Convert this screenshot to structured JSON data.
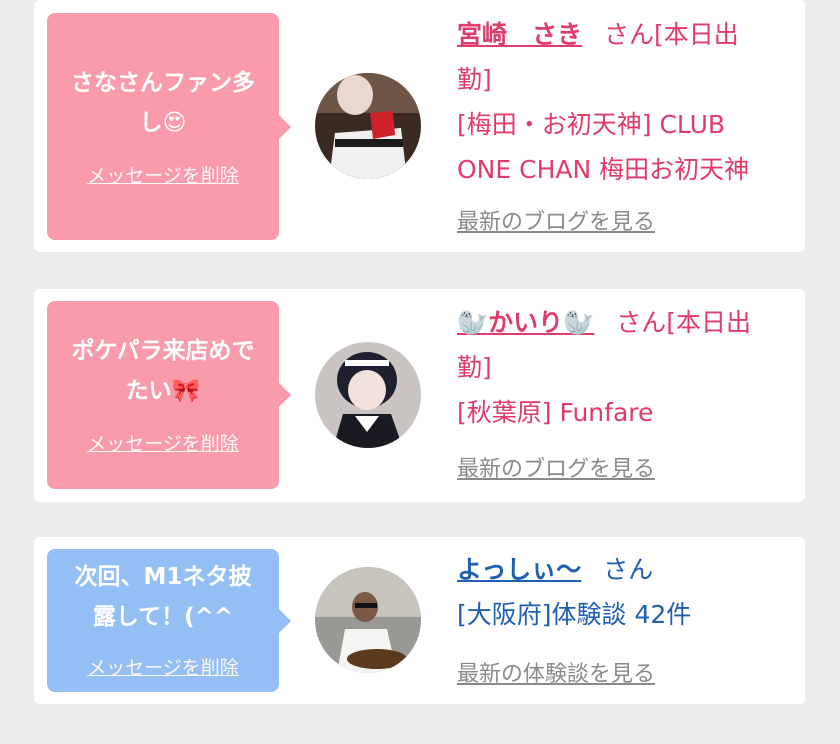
{
  "accent_pink": "#e03b6a",
  "accent_blue": "#1f5fb0",
  "cards": [
    {
      "message_line1": "さなさんファン多",
      "message_line2": "し",
      "message_emoji_icon": "heart-eyes-emoji",
      "message_emoji": "😍",
      "delete_label": "メッセージを削除",
      "name": "宮崎　さき",
      "suffix": "さん[本日出",
      "suffix2": "勤]",
      "shop_line1": "[梅田・お初天神] CLUB",
      "shop_line2": "ONE CHAN 梅田お初天神",
      "link_label": "最新のブログを見る"
    },
    {
      "message_line1": "ポケパラ来店めで",
      "message_line2": "たい",
      "message_emoji_icon": "ribbon-emoji",
      "message_emoji": "🎀",
      "delete_label": "メッセージを削除",
      "name_prefix_icon": "seal-emoji",
      "name_prefix": "🦭",
      "name": "かいり",
      "name_suffix": "🦭",
      "suffix": "さん[本日出",
      "suffix2": "勤]",
      "shop_line1": "[秋葉原] Funfare",
      "link_label": "最新のブログを見る"
    },
    {
      "message_line1": "次回、M1ネタ披",
      "message_line2": "露して！(^^",
      "delete_label": "メッセージを削除",
      "name": "よっしぃ〜",
      "suffix": "さん",
      "shop_line1": "[大阪府]体験談 42件",
      "link_label": "最新の体験談を見る"
    }
  ]
}
